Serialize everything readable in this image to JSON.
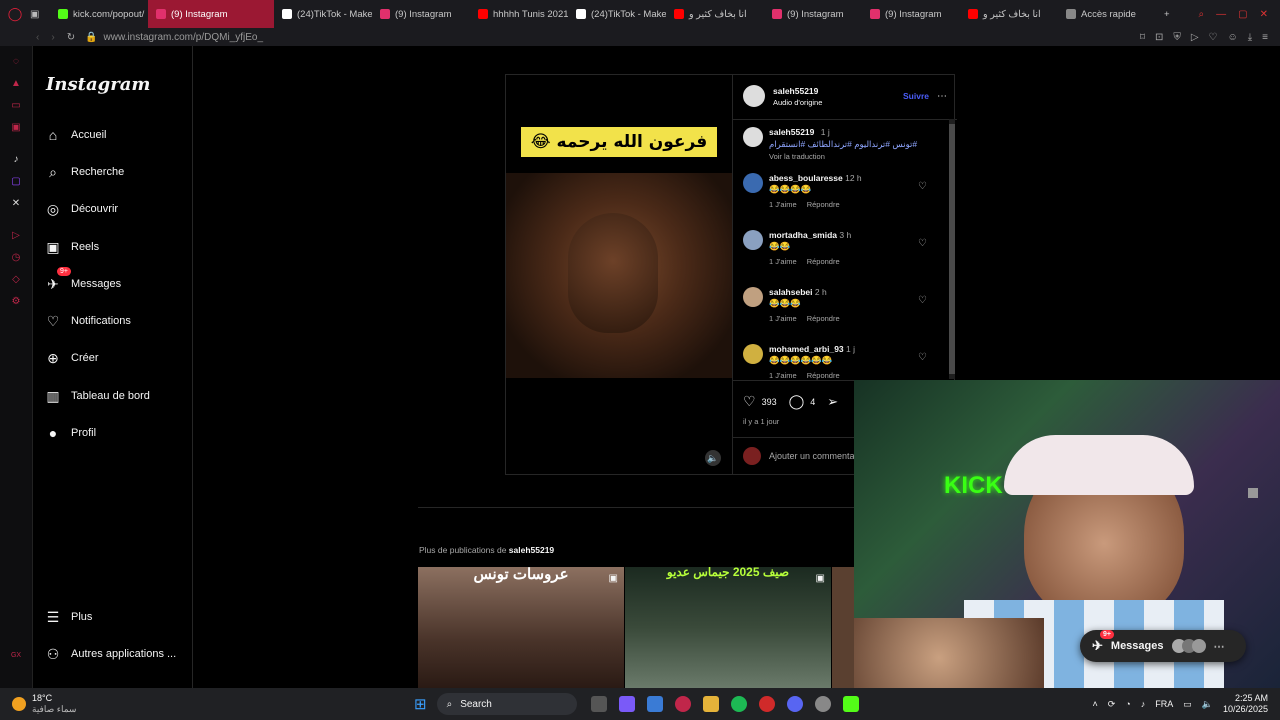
{
  "tabs": [
    {
      "label": "kick.com/popout/",
      "color": "#53fc18"
    },
    {
      "label": "(9) Instagram",
      "color": "#e1306c",
      "active": true
    },
    {
      "label": "(24)TikTok - Make",
      "color": "#ffffff"
    },
    {
      "label": "(9) Instagram",
      "color": "#e1306c"
    },
    {
      "label": "hhhhh Tunis 2021",
      "color": "#ff0000"
    },
    {
      "label": "(24)TikTok - Make",
      "color": "#ffffff"
    },
    {
      "label": "انا بخاف كثير و",
      "color": "#ff0000"
    },
    {
      "label": "(9) Instagram",
      "color": "#e1306c"
    },
    {
      "label": "(9) Instagram",
      "color": "#e1306c"
    },
    {
      "label": "انا بخاف كثير و",
      "color": "#ff0000"
    },
    {
      "label": "Accès rapide",
      "color": "#888888"
    }
  ],
  "url": "www.instagram.com/p/DQMi_yfjEo_",
  "ig": {
    "logo": "Instagram",
    "nav": [
      {
        "label": "Accueil",
        "icon": "home-icon",
        "glyph": "⌂"
      },
      {
        "label": "Recherche",
        "icon": "search-icon",
        "glyph": "⌕"
      },
      {
        "label": "Découvrir",
        "icon": "compass-icon",
        "glyph": "◎"
      },
      {
        "label": "Reels",
        "icon": "reels-icon",
        "glyph": "▣"
      },
      {
        "label": "Messages",
        "icon": "messenger-icon",
        "glyph": "✈",
        "badge": "9+"
      },
      {
        "label": "Notifications",
        "icon": "heart-icon",
        "glyph": "♡"
      },
      {
        "label": "Créer",
        "icon": "plus-icon",
        "glyph": "⊕"
      },
      {
        "label": "Tableau de bord",
        "icon": "dashboard-icon",
        "glyph": "▥"
      },
      {
        "label": "Profil",
        "icon": "profile-icon",
        "glyph": "●"
      }
    ],
    "more": "Plus",
    "other_apps": "Autres applications ..."
  },
  "post": {
    "caption": "فرعون الله يرحمه 😂",
    "author": "saleh55219",
    "audio": "Audio d'origine",
    "follow": "Suivre",
    "desc_user": "saleh55219",
    "desc_time": "1 j",
    "desc_text": "تونس #ترنداليوم #ترندالطائف #انستقرام#",
    "translate": "Voir la traduction",
    "comments": [
      {
        "user": "abess_boularesse",
        "time": "12 h",
        "text": "😂😂😂😂",
        "likes": "1 J'aime",
        "reply": "Répondre"
      },
      {
        "user": "mortadha_smida",
        "time": "3 h",
        "text": "😂😂",
        "likes": "1 J'aime",
        "reply": "Répondre"
      },
      {
        "user": "salahsebei",
        "time": "2 h",
        "text": "😂😂😂",
        "likes": "1 J'aime",
        "reply": "Répondre"
      },
      {
        "user": "mohamed_arbi_93",
        "time": "1 j",
        "text": "😂😂😂😂😂😂",
        "likes": "1 J'aime",
        "reply": "Répondre"
      }
    ],
    "likes": "393",
    "comment_count": "4",
    "date": "il y a 1 jour",
    "add_comment": "Ajouter un commentaire..."
  },
  "more_posts_prefix": "Plus de publications de ",
  "more_posts_user": "saleh55219",
  "thumb_captions": [
    "عروسات تونس",
    "صيف 2025 جيماس عديو"
  ],
  "messages": {
    "label": "Messages",
    "badge": "9+"
  },
  "taskbar": {
    "weather_temp": "18°C",
    "weather_desc": "سماء صافية",
    "search": "Search",
    "lang": "FRA",
    "time": "2:25 AM",
    "date": "10/26/2025"
  },
  "webcam": {
    "sign": "KICK"
  }
}
